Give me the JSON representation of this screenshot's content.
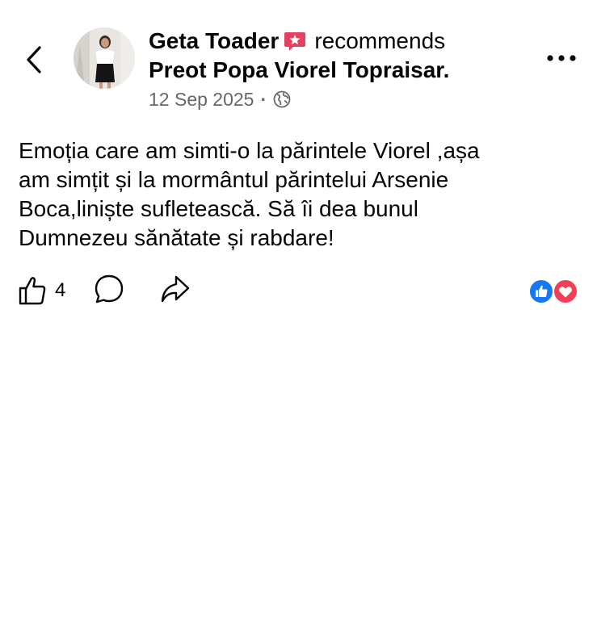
{
  "header": {
    "back_icon": "chevron-left-icon",
    "author_name": "Geta Toader",
    "recommend_badge_icon": "recommendation-star-icon",
    "recommends_text": "recommends",
    "page_name": "Preot Popa Viorel Topraisar.",
    "date": "12 Sep 2025",
    "separator": "·",
    "privacy_icon": "globe-icon",
    "more_icon": "more-options-icon",
    "badge_color": "#e4405f"
  },
  "post": {
    "lines": [
      "Emoția care am simti-o la părintele Viorel ,așa",
      "am simțit și la mormântul părintelui Arsenie",
      "Boca,liniște sufletească. Să îi dea bunul",
      "Dumnezeu sănătate și rabdare!"
    ]
  },
  "actions": {
    "like_icon": "thumbs-up-icon",
    "like_count": "4",
    "comment_icon": "comment-icon",
    "share_icon": "share-icon"
  },
  "reactions": {
    "items": [
      "like-reaction-icon",
      "love-reaction-icon"
    ],
    "like_color": "#1877f2",
    "love_color": "#f33e58"
  }
}
